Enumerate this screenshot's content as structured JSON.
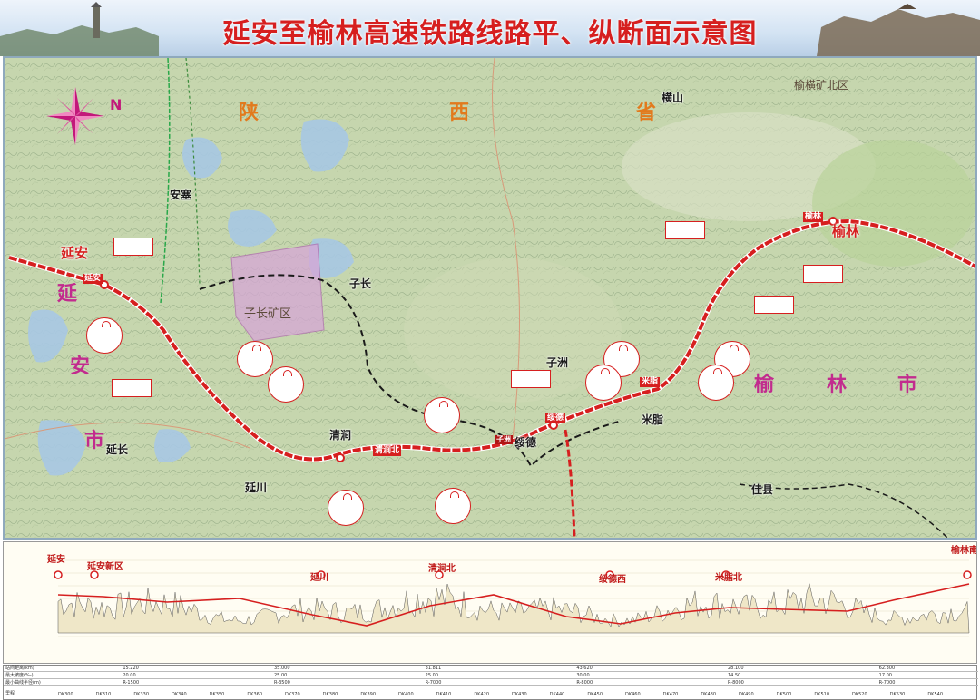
{
  "title": "延安至榆林高速铁路线路平、纵断面示意图",
  "colors": {
    "rail": "#d61f1f",
    "title": "#d61f1f",
    "province_text": "#e27a1d",
    "region_text": "#c22b8e"
  },
  "map": {
    "compass_icon": "compass-rose-icon",
    "north_letter": "N",
    "province": [
      "陕",
      "西",
      "省"
    ],
    "cities": {
      "yanan_city": "延安",
      "yulin_city": "榆林",
      "ansai": "安塞",
      "zichang": "子长",
      "qingjian": "清涧",
      "zizhou": "子洲",
      "suide": "绥德",
      "mizhi": "米脂",
      "jiaxian": "佳县",
      "yanchuan": "延川",
      "yanchang": "延长",
      "hengshan": "横山"
    },
    "region_yanan": [
      "延",
      "安",
      "市"
    ],
    "region_yulin": [
      "榆",
      "林",
      "市"
    ],
    "mining_zichang": "子长矿区",
    "mining_yuheng": "榆横矿北区",
    "stations": {
      "yanan": "延安",
      "qingjianbei": "清涧北",
      "suide": "绥德",
      "yulin": "榆林",
      "zizhou": "子洲",
      "mizhi": "米脂"
    }
  },
  "profile": {
    "stations": [
      "延安",
      "延安新区",
      "延川",
      "清涧北",
      "绥德西",
      "米脂北",
      "榆林南"
    ]
  },
  "table": {
    "rows": [
      {
        "header": "站间距离(km)",
        "values": [
          "15.220",
          "35.000",
          "31.811",
          "43.620",
          "28.100",
          "62.300"
        ]
      },
      {
        "header": "最大坡度(‰)",
        "values": [
          "20.00",
          "25.00",
          "25.00",
          "30.00",
          "14.50",
          "17.00"
        ]
      },
      {
        "header": "最小曲线半径(m)",
        "values": [
          "R-1500",
          "R-3500",
          "R-7000",
          "R-8000",
          "R-8000",
          "R-7000"
        ]
      },
      {
        "header": "里程",
        "values": [
          "DK300",
          "DK310",
          "DK330",
          "DK340",
          "DK350",
          "DK360",
          "DK370",
          "DK380",
          "DK390",
          "DK400",
          "DK410",
          "DK420",
          "DK430",
          "DK440",
          "DK450",
          "DK460",
          "DK470",
          "DK480",
          "DK490",
          "DK500",
          "DK510",
          "DK520",
          "DK530",
          "DK540"
        ]
      }
    ]
  }
}
